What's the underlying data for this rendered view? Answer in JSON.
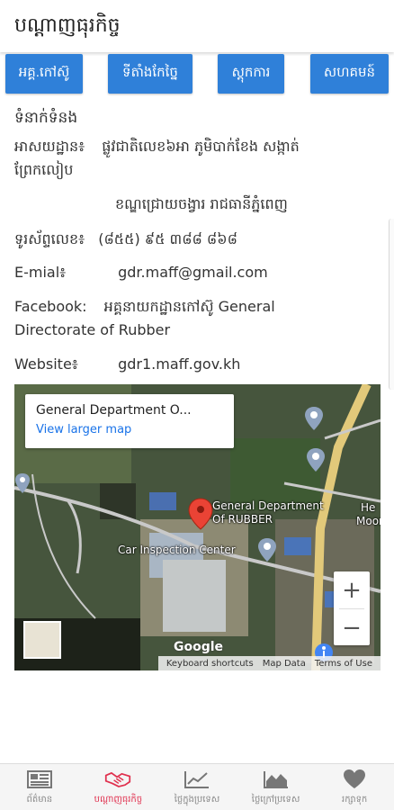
{
  "app": {
    "title": "បណ្តាញធុរកិច្ច"
  },
  "tabs": [
    {
      "label": "អគ្គ.កៅស៊ូ"
    },
    {
      "label": "ទីតាំងកែច្នៃ"
    },
    {
      "label": "ស្តុកការ"
    },
    {
      "label": "សហគមន៍"
    }
  ],
  "contact": {
    "heading": "ទំនាក់ទំនង",
    "address_label": "អាសយដ្ឋាន៖",
    "address_line1": "ផ្លូវជាតិលេខ៦អា ភូមិបាក់ខែង សង្កាត់",
    "address_line2": "ព្រែកលៀប",
    "address_line3": "ខណ្ឌជ្រោយចង្វារ រាជធានីភ្នំពេញ",
    "phone_label": "ទូរស័ព្ទលេខ៖",
    "phone_value": "(៨៥៥) ៩៥ ៣៨៨ ៨៦៨",
    "email_label": "E-mial៖",
    "email_value": "gdr.maff@gmail.com",
    "facebook_label": "Facebook:",
    "facebook_value_line1": "អគ្គនាយកដ្ឋានកៅស៊ូ General",
    "facebook_value_line2": "Directorate of Rubber",
    "website_label": "Website៖",
    "website_value": "gdr1.maff.gov.kh"
  },
  "map": {
    "place_name": "General Department O...",
    "larger_map": "View larger map",
    "marker_label_line1": "General Department",
    "marker_label_line2": "Of RUBBER",
    "poi_car": "Car Inspection Center",
    "poi_he": "He",
    "poi_moon": "Moonl",
    "zoom_in": "+",
    "zoom_out": "−",
    "google": "Google",
    "keyboard": "Keyboard shortcuts",
    "map_data": "Map Data",
    "terms": "Terms of Use",
    "marker_color": "#ea4335",
    "road_color": "#e2c97a"
  },
  "nav": [
    {
      "label": "ព័ត៌មាន",
      "icon": "newspaper-icon"
    },
    {
      "label": "បណ្តាញធុរកិច្ច",
      "icon": "handshake-icon"
    },
    {
      "label": "ថ្លៃក្នុងប្រទេស",
      "icon": "line-chart-icon"
    },
    {
      "label": "ថ្លៃក្រៅប្រទេស",
      "icon": "area-chart-icon"
    },
    {
      "label": "រក្សាទុក",
      "icon": "heart-icon"
    }
  ],
  "colors": {
    "accent": "#2f80d9",
    "nav_active": "#e0314f",
    "nav_inactive": "#888888"
  }
}
